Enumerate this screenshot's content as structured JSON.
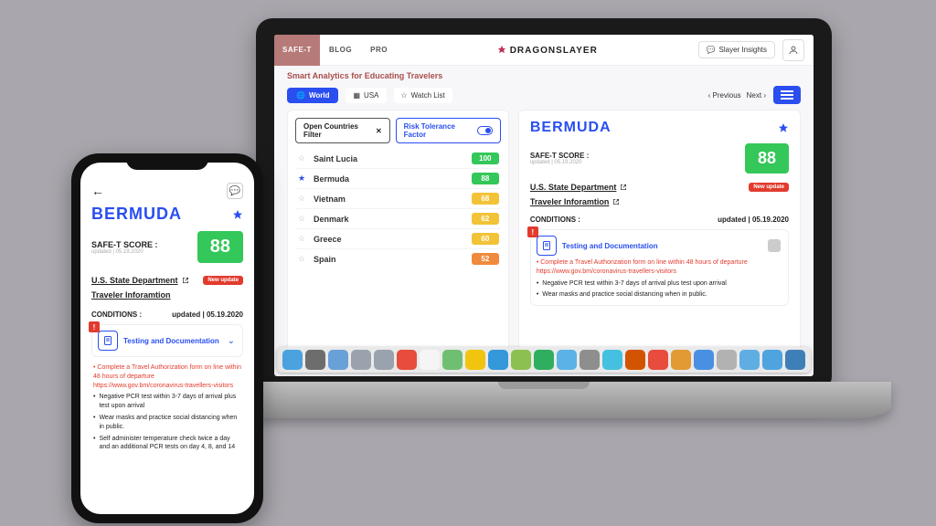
{
  "laptop": {
    "tabs": {
      "safet": "SAFE-T",
      "blog": "BLOG",
      "pro": "PRO"
    },
    "brand": "DRAGONSLAYER",
    "insights_btn": "Slayer Insights",
    "subtitle": "Smart Analytics for Educating Travelers",
    "filters": {
      "world": "World",
      "usa": "USA",
      "watchlist": "Watch List",
      "prev": "‹ Previous",
      "next": "Next ›",
      "open_countries": "Open Countries Filter",
      "risk_tolerance": "Risk Tolerance Factor"
    },
    "countries": [
      {
        "name": "Saint Lucia",
        "score": "100",
        "color": "#34c759",
        "starred": false
      },
      {
        "name": "Bermuda",
        "score": "88",
        "color": "#34c759",
        "starred": true
      },
      {
        "name": "Vietnam",
        "score": "68",
        "color": "#f2c337",
        "starred": false
      },
      {
        "name": "Denmark",
        "score": "62",
        "color": "#f2c337",
        "starred": false
      },
      {
        "name": "Greece",
        "score": "60",
        "color": "#f2c337",
        "starred": false
      },
      {
        "name": "Spain",
        "score": "52",
        "color": "#f08a3c",
        "starred": false
      }
    ],
    "detail": {
      "country": "BERMUDA",
      "score_label": "SAFE-T SCORE :",
      "score": "88",
      "updated": "updated | 05.19.2020",
      "link_state": "U.S. State Department",
      "link_traveler": "Traveler Inforamtion",
      "new_update": "New update",
      "conditions_label": "CONDITIONS :",
      "cond_title": "Testing and Documentation",
      "cond_red": "Complete a Travel Authorization form on line within 48 hours of departure https://www.gov.bm/coronavirus-travellers-visitors",
      "cond_b1": "Negative PCR test within 3-7 days of arrival plus test upon arrival",
      "cond_b2": "Wear masks and practice social distancing when in public."
    }
  },
  "phone": {
    "country": "BERMUDA",
    "score_label": "SAFE-T SCORE :",
    "score": "88",
    "updated": "updated | 05.19.2020",
    "link_state": "U.S. State Department",
    "link_traveler": "Traveler Inforamtion",
    "new_update": "New update",
    "conditions_label": "CONDITIONS :",
    "cond_title": "Testing and Documentation",
    "cond_red": "Complete a Travel Authorization form on line within 48 hours of departure https://www.gov.bm/coronavirus-travellers-visitors",
    "cond_b1": "Negative PCR test within 3-7 days of arrival plus test upon arrival",
    "cond_b2": "Wear masks and practice social distancing when in public.",
    "cond_b3": "Self administer temperature check twice a day and an additional PCR tests on day 4, 8, and 14"
  },
  "dock_colors": [
    "#4aa3df",
    "#6d6d6d",
    "#6aa0d8",
    "#9aa3ad",
    "#9aa3ad",
    "#e74c3c",
    "#f5f5f5",
    "#6fbf73",
    "#f1c40f",
    "#3498db",
    "#8cc152",
    "#2fae60",
    "#5ab3e4",
    "#8e8e8e",
    "#46c0e0",
    "#d35400",
    "#e74c3c",
    "#e29a35",
    "#4a90e2",
    "#b2b2b2",
    "#5faee3",
    "#4fa3df",
    "#3f7fb8"
  ]
}
